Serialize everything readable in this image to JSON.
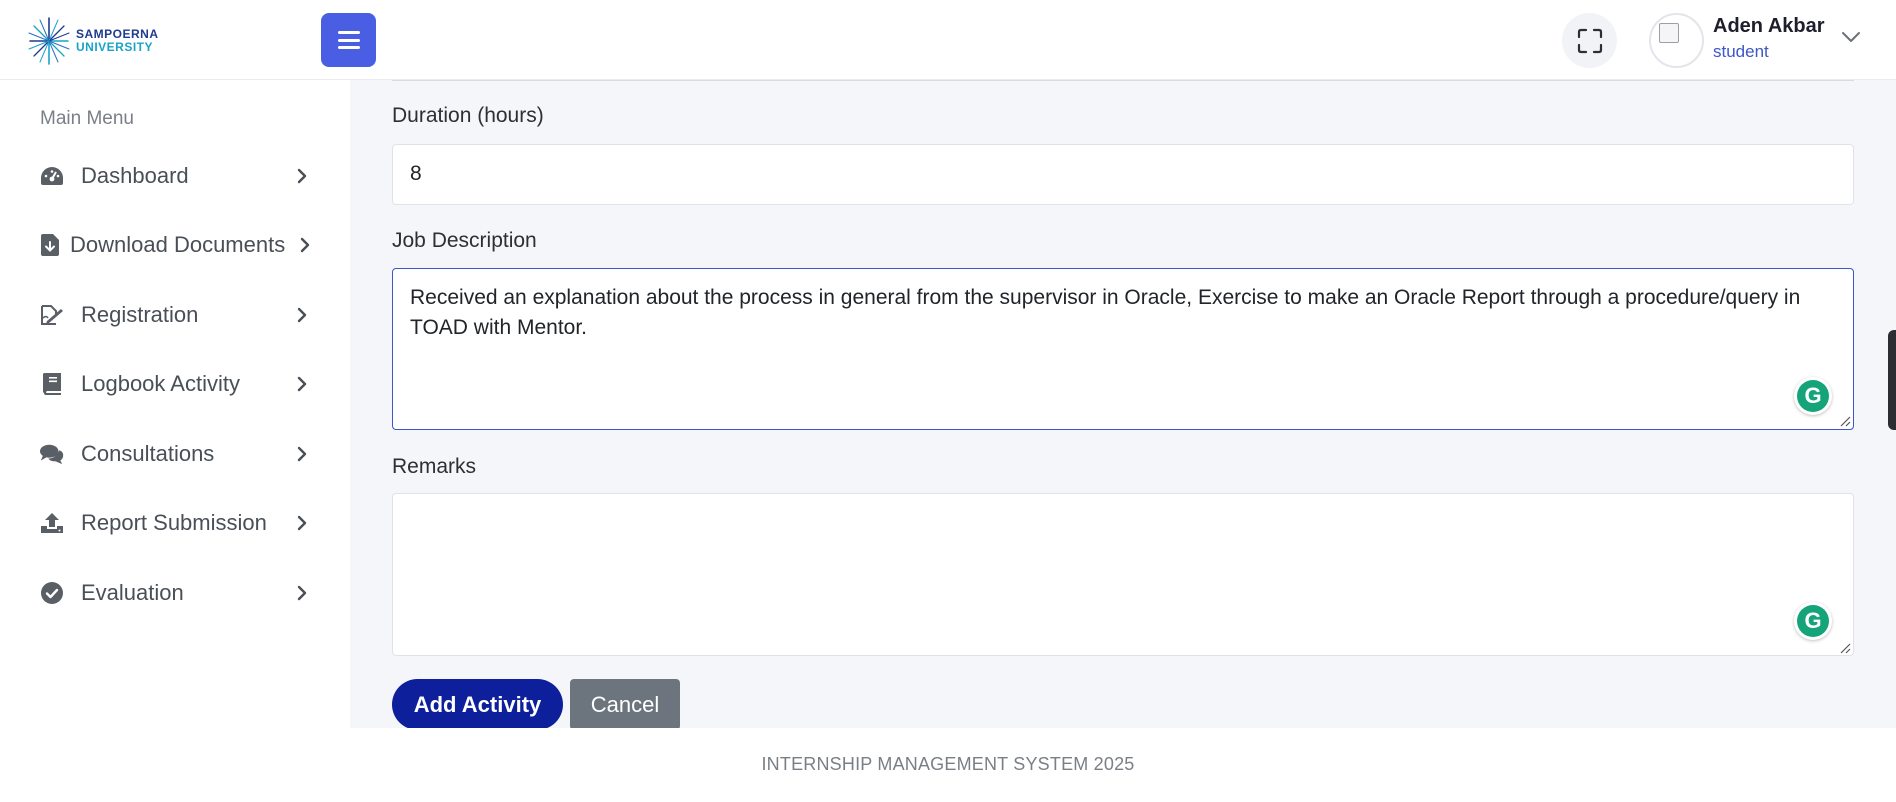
{
  "header": {
    "logo": {
      "line1": "SAMPOERNA",
      "line2": "UNIVERSITY"
    },
    "user": {
      "name": "Aden Akbar",
      "role": "student"
    }
  },
  "sidebar": {
    "title": "Main Menu",
    "items": [
      {
        "label": "Dashboard",
        "icon": "gauge-icon"
      },
      {
        "label": "Download Documents",
        "icon": "file-download-icon"
      },
      {
        "label": "Registration",
        "icon": "signature-icon"
      },
      {
        "label": "Logbook Activity",
        "icon": "book-icon"
      },
      {
        "label": "Consultations",
        "icon": "comments-icon"
      },
      {
        "label": "Report Submission",
        "icon": "upload-icon"
      },
      {
        "label": "Evaluation",
        "icon": "check-circle-icon"
      }
    ]
  },
  "form": {
    "duration": {
      "label": "Duration (hours)",
      "value": "8"
    },
    "job_description": {
      "label": "Job Description",
      "value": "Received an explanation about the process in general from the supervisor in Oracle, Exercise to make an Oracle Report through a procedure/query in TOAD with Mentor."
    },
    "remarks": {
      "label": "Remarks",
      "value": ""
    },
    "add_button": "Add Activity",
    "cancel_button": "Cancel"
  },
  "footer": {
    "text": "INTERNSHIP MANAGEMENT SYSTEM 2025"
  },
  "colors": {
    "primary": "#4a5ee3",
    "add_button": "#0d1f9b",
    "cancel_button": "#6c757d",
    "role_text": "#3b57c9",
    "grammarly": "#15a47a"
  }
}
